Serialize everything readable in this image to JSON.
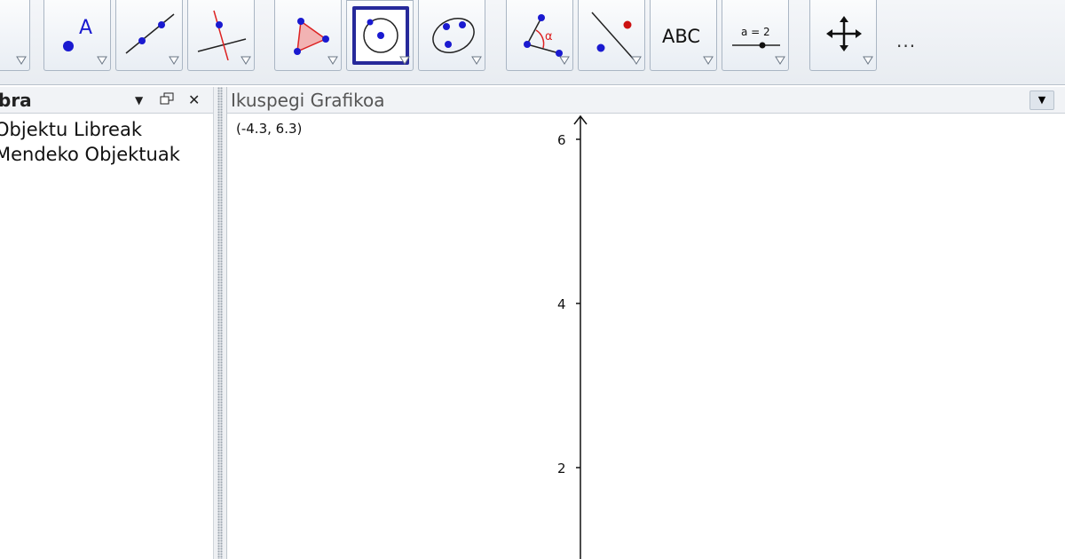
{
  "toolbar": {
    "tools": [
      {
        "name": "move-tool",
        "icon": "move-arrow-icon"
      },
      {
        "name": "point-tool",
        "icon": "point-icon",
        "label": "A"
      },
      {
        "name": "line-tool",
        "icon": "line-through-points-icon"
      },
      {
        "name": "perpendicular-tool",
        "icon": "perpendicular-line-icon"
      },
      {
        "name": "polygon-tool",
        "icon": "polygon-icon"
      },
      {
        "name": "circle-tool",
        "icon": "circle-center-point-icon",
        "selected": true
      },
      {
        "name": "ellipse-tool",
        "icon": "ellipse-icon"
      },
      {
        "name": "angle-tool",
        "icon": "angle-icon",
        "label": "α"
      },
      {
        "name": "reflect-tool",
        "icon": "reflect-about-line-icon"
      },
      {
        "name": "text-tool",
        "icon": "text-icon",
        "label": "ABC"
      },
      {
        "name": "slider-tool",
        "icon": "slider-icon",
        "label": "a = 2"
      },
      {
        "name": "move-view-tool",
        "icon": "move-graphics-view-icon"
      }
    ],
    "more_label": "..."
  },
  "algebra": {
    "title": "bra",
    "items": [
      "Objektu Libreak",
      "Mendeko Objektuak"
    ]
  },
  "graphics": {
    "title": "Ikuspegi Grafikoa",
    "coordinates": "(-4.3, 6.3)",
    "y_ticks": [
      "6",
      "4",
      "2"
    ]
  },
  "colors": {
    "accent_selected": "#26299a",
    "point_blue": "#1a1ad0",
    "point_red": "#cc1111",
    "polygon_fill": "#f2b3b3"
  }
}
